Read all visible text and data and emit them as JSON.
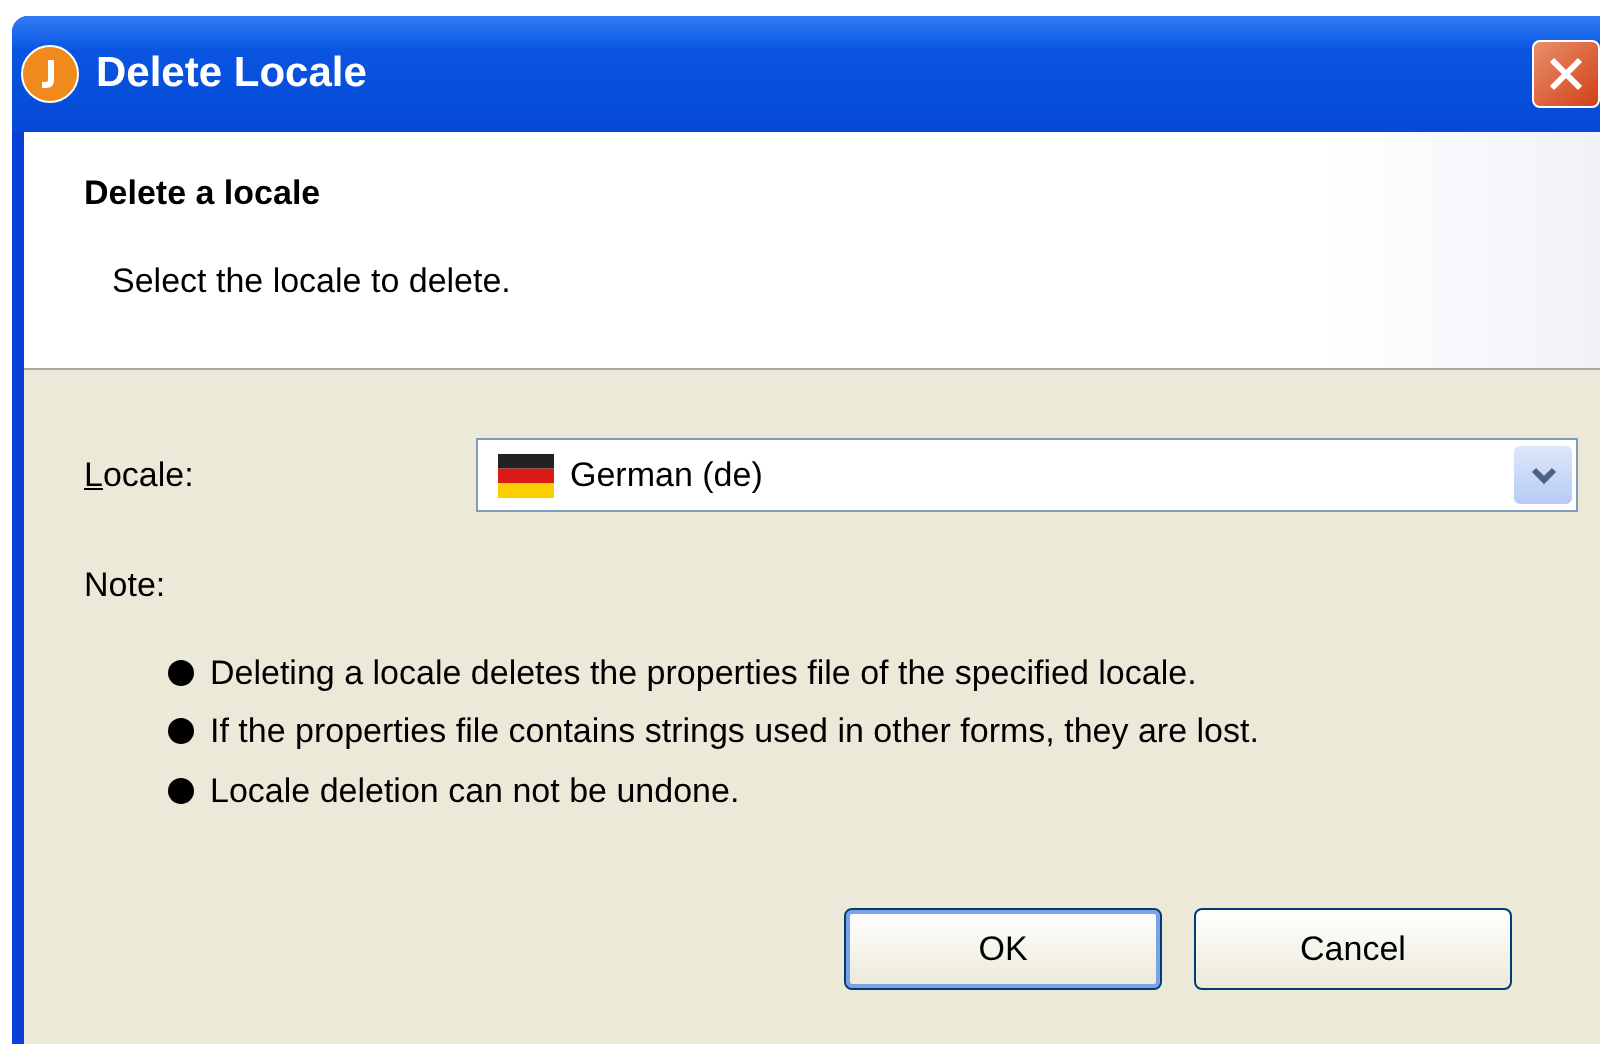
{
  "window": {
    "title": "Delete Locale"
  },
  "header": {
    "title": "Delete a locale",
    "description": "Select the locale to delete."
  },
  "locale_field": {
    "label": "Locale:",
    "value": "German (de)"
  },
  "note": {
    "label": "Note:",
    "items": [
      "Deleting a locale deletes the properties file of the specified locale.",
      "If the properties file contains strings used in other forms, they are lost.",
      "Locale deletion can not be undone."
    ]
  },
  "buttons": [
    {
      "label": "OK",
      "default": true
    },
    {
      "label": "Cancel",
      "default": false
    }
  ]
}
